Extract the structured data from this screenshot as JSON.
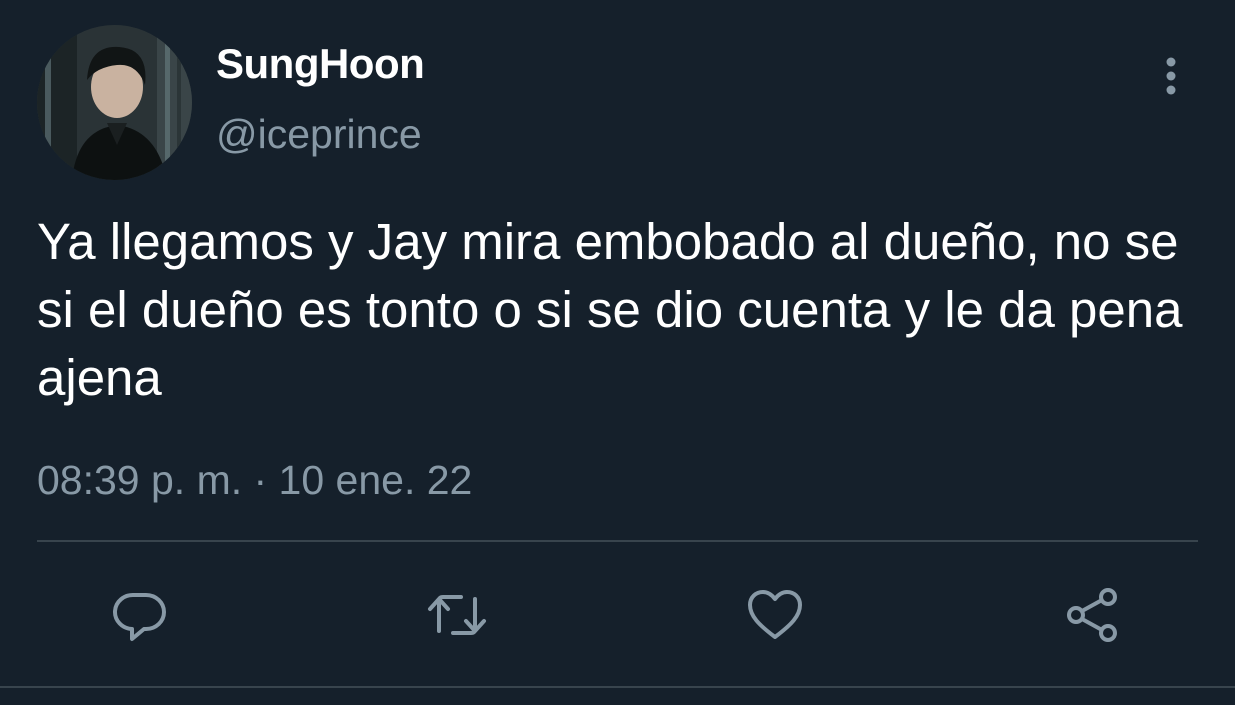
{
  "user": {
    "display_name": "SungHoon",
    "handle": "@iceprince"
  },
  "tweet": {
    "text": "Ya llegamos y Jay mira embobado al dueño, no se si el dueño es tonto o si se dio cuenta y le da pena ajena",
    "timestamp": "08:39 p. m. · 10 ene. 22"
  },
  "icons": {
    "more": "more-vertical-icon",
    "reply": "reply-icon",
    "retweet": "retweet-icon",
    "like": "heart-icon",
    "share": "share-icon"
  },
  "colors": {
    "background": "#15202b",
    "primary_text": "#ffffff",
    "secondary_text": "#8899a6",
    "divider": "#38444d"
  }
}
